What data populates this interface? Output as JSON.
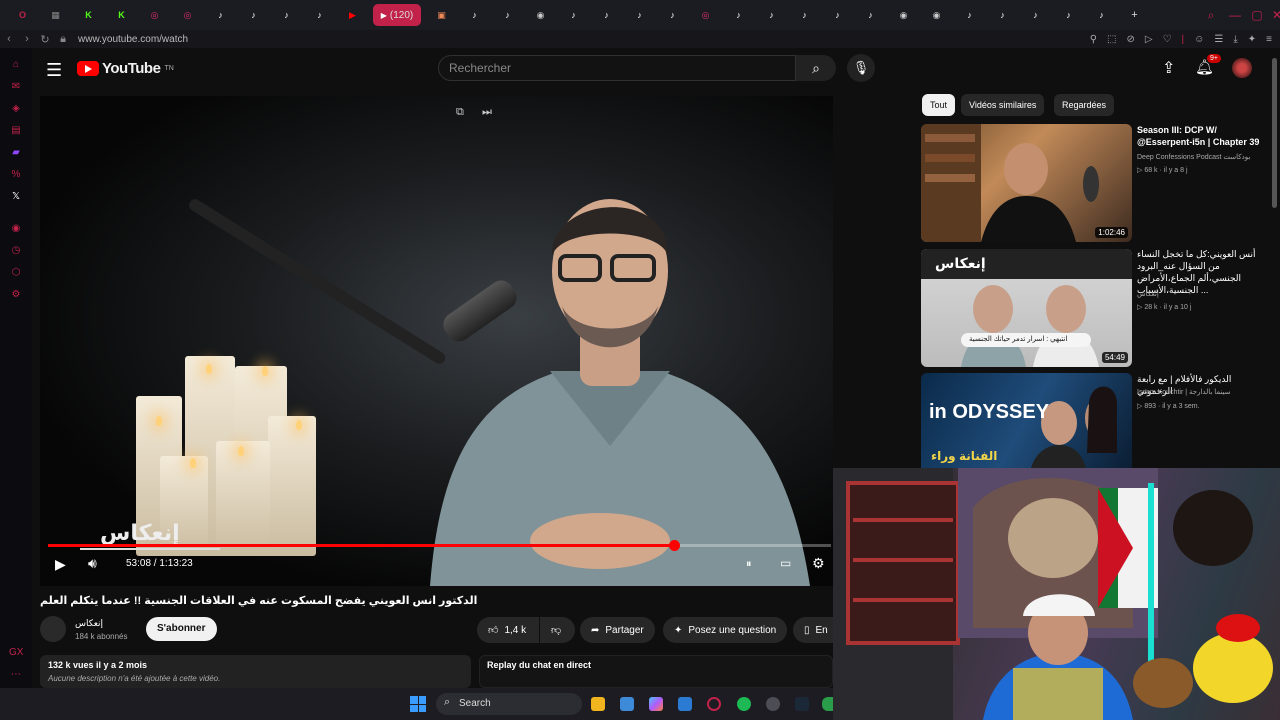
{
  "browser": {
    "active_tab_label": "(120)",
    "url": "www.youtube.com/watch",
    "tabs": [
      {
        "icon": "opera-icon",
        "color": "#c2224a",
        "glyph": "O"
      },
      {
        "icon": "gamepad-icon",
        "color": "#888",
        "glyph": "▦"
      },
      {
        "icon": "kick-icon",
        "color": "#53fc18",
        "glyph": "K"
      },
      {
        "icon": "kick-icon",
        "color": "#53fc18",
        "glyph": "K"
      },
      {
        "icon": "instagram-icon",
        "color": "#e1306c",
        "glyph": "◎"
      },
      {
        "icon": "instagram-icon",
        "color": "#e1306c",
        "glyph": "◎"
      },
      {
        "icon": "tiktok-icon",
        "color": "#ffffff",
        "glyph": "♪"
      },
      {
        "icon": "tiktok-icon",
        "color": "#ffffff",
        "glyph": "♪"
      },
      {
        "icon": "tiktok-icon",
        "color": "#ffffff",
        "glyph": "♪"
      },
      {
        "icon": "tiktok-icon",
        "color": "#ffffff",
        "glyph": "♪"
      },
      {
        "icon": "youtube-icon",
        "color": "#ff0000",
        "glyph": "▶"
      },
      {
        "icon": "gift-icon",
        "color": "#e85",
        "glyph": "▣"
      },
      {
        "icon": "tiktok-icon",
        "color": "#ffffff",
        "glyph": "♪"
      },
      {
        "icon": "tiktok-icon",
        "color": "#ffffff",
        "glyph": "♪"
      },
      {
        "icon": "chat-icon",
        "color": "#ccc",
        "glyph": "◉"
      },
      {
        "icon": "tiktok-icon",
        "color": "#ffffff",
        "glyph": "♪"
      },
      {
        "icon": "tiktok-icon",
        "color": "#ffffff",
        "glyph": "♪"
      },
      {
        "icon": "tiktok-icon",
        "color": "#ffffff",
        "glyph": "♪"
      },
      {
        "icon": "tiktok-icon",
        "color": "#ffffff",
        "glyph": "♪"
      },
      {
        "icon": "instagram-icon",
        "color": "#e1306c",
        "glyph": "◎"
      },
      {
        "icon": "tiktok-icon",
        "color": "#ffffff",
        "glyph": "♪"
      },
      {
        "icon": "tiktok-icon",
        "color": "#ffffff",
        "glyph": "♪"
      },
      {
        "icon": "tiktok-icon",
        "color": "#ffffff",
        "glyph": "♪"
      },
      {
        "icon": "tiktok-icon",
        "color": "#ffffff",
        "glyph": "♪"
      },
      {
        "icon": "tiktok-icon",
        "color": "#ffffff",
        "glyph": "♪"
      },
      {
        "icon": "chat-icon",
        "color": "#ccc",
        "glyph": "◉"
      },
      {
        "icon": "chat-icon",
        "color": "#ccc",
        "glyph": "◉"
      },
      {
        "icon": "tiktok-icon",
        "color": "#ffffff",
        "glyph": "♪"
      },
      {
        "icon": "tiktok-icon",
        "color": "#ffffff",
        "glyph": "♪"
      },
      {
        "icon": "tiktok-icon",
        "color": "#ffffff",
        "glyph": "♪"
      },
      {
        "icon": "tiktok-icon",
        "color": "#ffffff",
        "glyph": "♪"
      },
      {
        "icon": "tiktok-icon",
        "color": "#ffffff",
        "glyph": "♪"
      }
    ]
  },
  "youtube": {
    "logo_text": "YouTube",
    "logo_sup": "TN",
    "search_placeholder": "Rechercher",
    "notifications_badge": "9+"
  },
  "player": {
    "time": "53:08 / 1:13:23",
    "progress": 0.8,
    "watermark": "إنعكاس"
  },
  "video": {
    "title": "الدكتور انس العويني يفضح المسكوت عنه في العلاقات الجنسية !! عندما يتكلم العلم",
    "channel_name": "إنعكاس",
    "channel_subs": "184 k abonnés",
    "subscribe_label": "S'abonner",
    "likes": "1,4 k",
    "share_label": "Partager",
    "ask_label": "Posez une question",
    "save_label": "En",
    "views_date": "132 k vues  il y a 2 mois",
    "description": "Aucune description n'a été ajoutée à cette vidéo.",
    "chat_replay": "Replay du chat en direct"
  },
  "chips": [
    "Tout",
    "Vidéos similaires",
    "Regardées"
  ],
  "recommendations": [
    {
      "title": "Season III: DCP W/ @Esserpent-i5n | Chapter 39",
      "channel": "Deep Confessions Podcast بودكاست",
      "meta": "▷ 68 k · il y a 8 j",
      "duration": "1:02:46"
    },
    {
      "title": "أنس العويني:كل ما تخجل النساء من السؤال عنه_البرود الجنسي،ألم الجماع،الأمراض الجنسية،الأسباب ...",
      "channel": "إنعكاس",
      "meta": "▷ 28 k · il y a 10 j",
      "duration": "54:49",
      "thumb_caption": "إنعكاس",
      "thumb_sub": "انتبهي : اسرار تدمر حياتك الجنسية"
    },
    {
      "title": "الديكور فالأفلام | مع رابعة الرحموني",
      "channel": "Issam Kouchtir | سينما بالدارجة",
      "meta": "▷ 893 · il y a 3 sem.",
      "thumb_caption": "in ODYSSEY",
      "thumb_sub": "الفنانة وراء"
    }
  ],
  "taskbar": {
    "search_label": "Search"
  }
}
